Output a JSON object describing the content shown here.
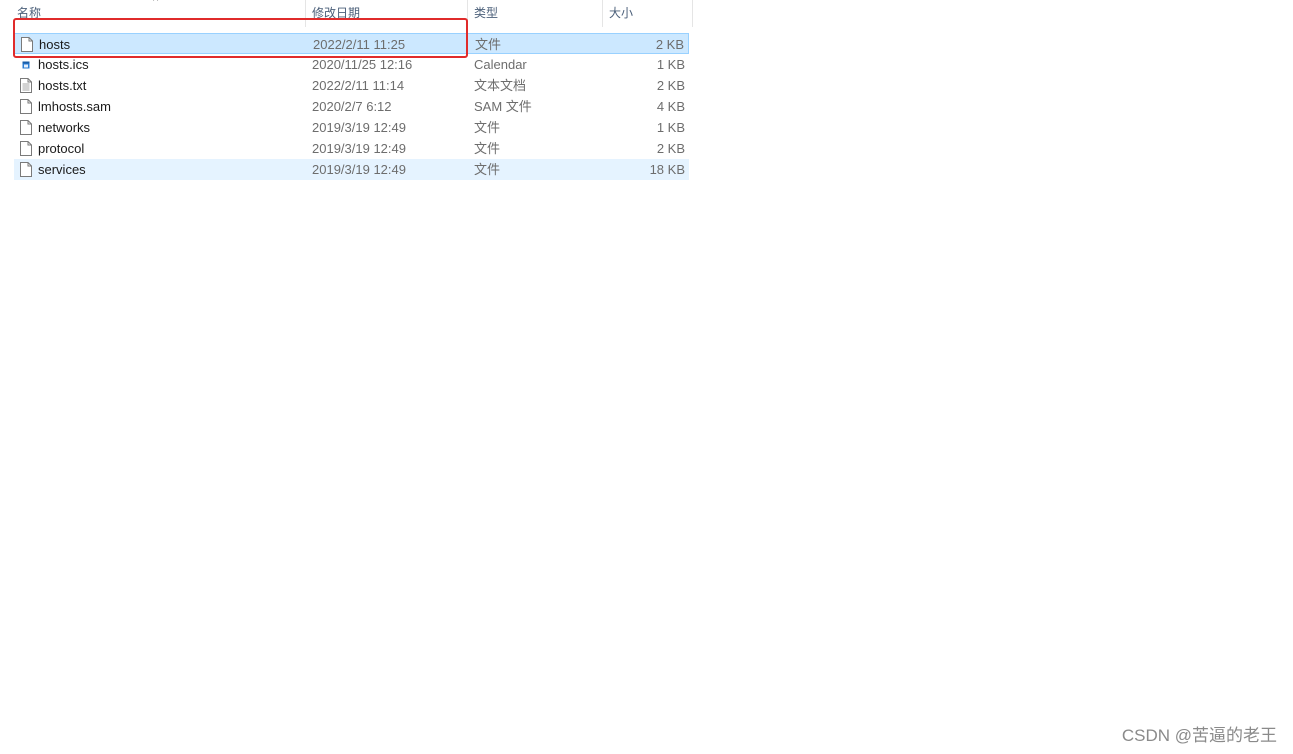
{
  "columns": {
    "name": "名称",
    "date": "修改日期",
    "type": "类型",
    "size": "大小"
  },
  "files": [
    {
      "name": "hosts",
      "date": "2022/2/11 11:25",
      "type": "文件",
      "size": "2 KB",
      "icon": "blank-file-icon",
      "state": "selected"
    },
    {
      "name": "hosts.ics",
      "date": "2020/11/25 12:16",
      "type": "Calendar",
      "size": "1 KB",
      "icon": "calendar-file-icon",
      "state": "normal"
    },
    {
      "name": "hosts.txt",
      "date": "2022/2/11 11:14",
      "type": "文本文档",
      "size": "2 KB",
      "icon": "text-file-icon",
      "state": "normal"
    },
    {
      "name": "lmhosts.sam",
      "date": "2020/2/7 6:12",
      "type": "SAM 文件",
      "size": "4 KB",
      "icon": "blank-file-icon",
      "state": "normal"
    },
    {
      "name": "networks",
      "date": "2019/3/19 12:49",
      "type": "文件",
      "size": "1 KB",
      "icon": "blank-file-icon",
      "state": "normal"
    },
    {
      "name": "protocol",
      "date": "2019/3/19 12:49",
      "type": "文件",
      "size": "2 KB",
      "icon": "blank-file-icon",
      "state": "normal"
    },
    {
      "name": "services",
      "date": "2019/3/19 12:49",
      "type": "文件",
      "size": "18 KB",
      "icon": "blank-file-icon",
      "state": "hovered"
    }
  ],
  "watermark": "CSDN @苦逼的老王",
  "colors": {
    "selection": "#cce8ff",
    "hover": "#e5f3ff",
    "highlight_box": "#e02b2b"
  }
}
